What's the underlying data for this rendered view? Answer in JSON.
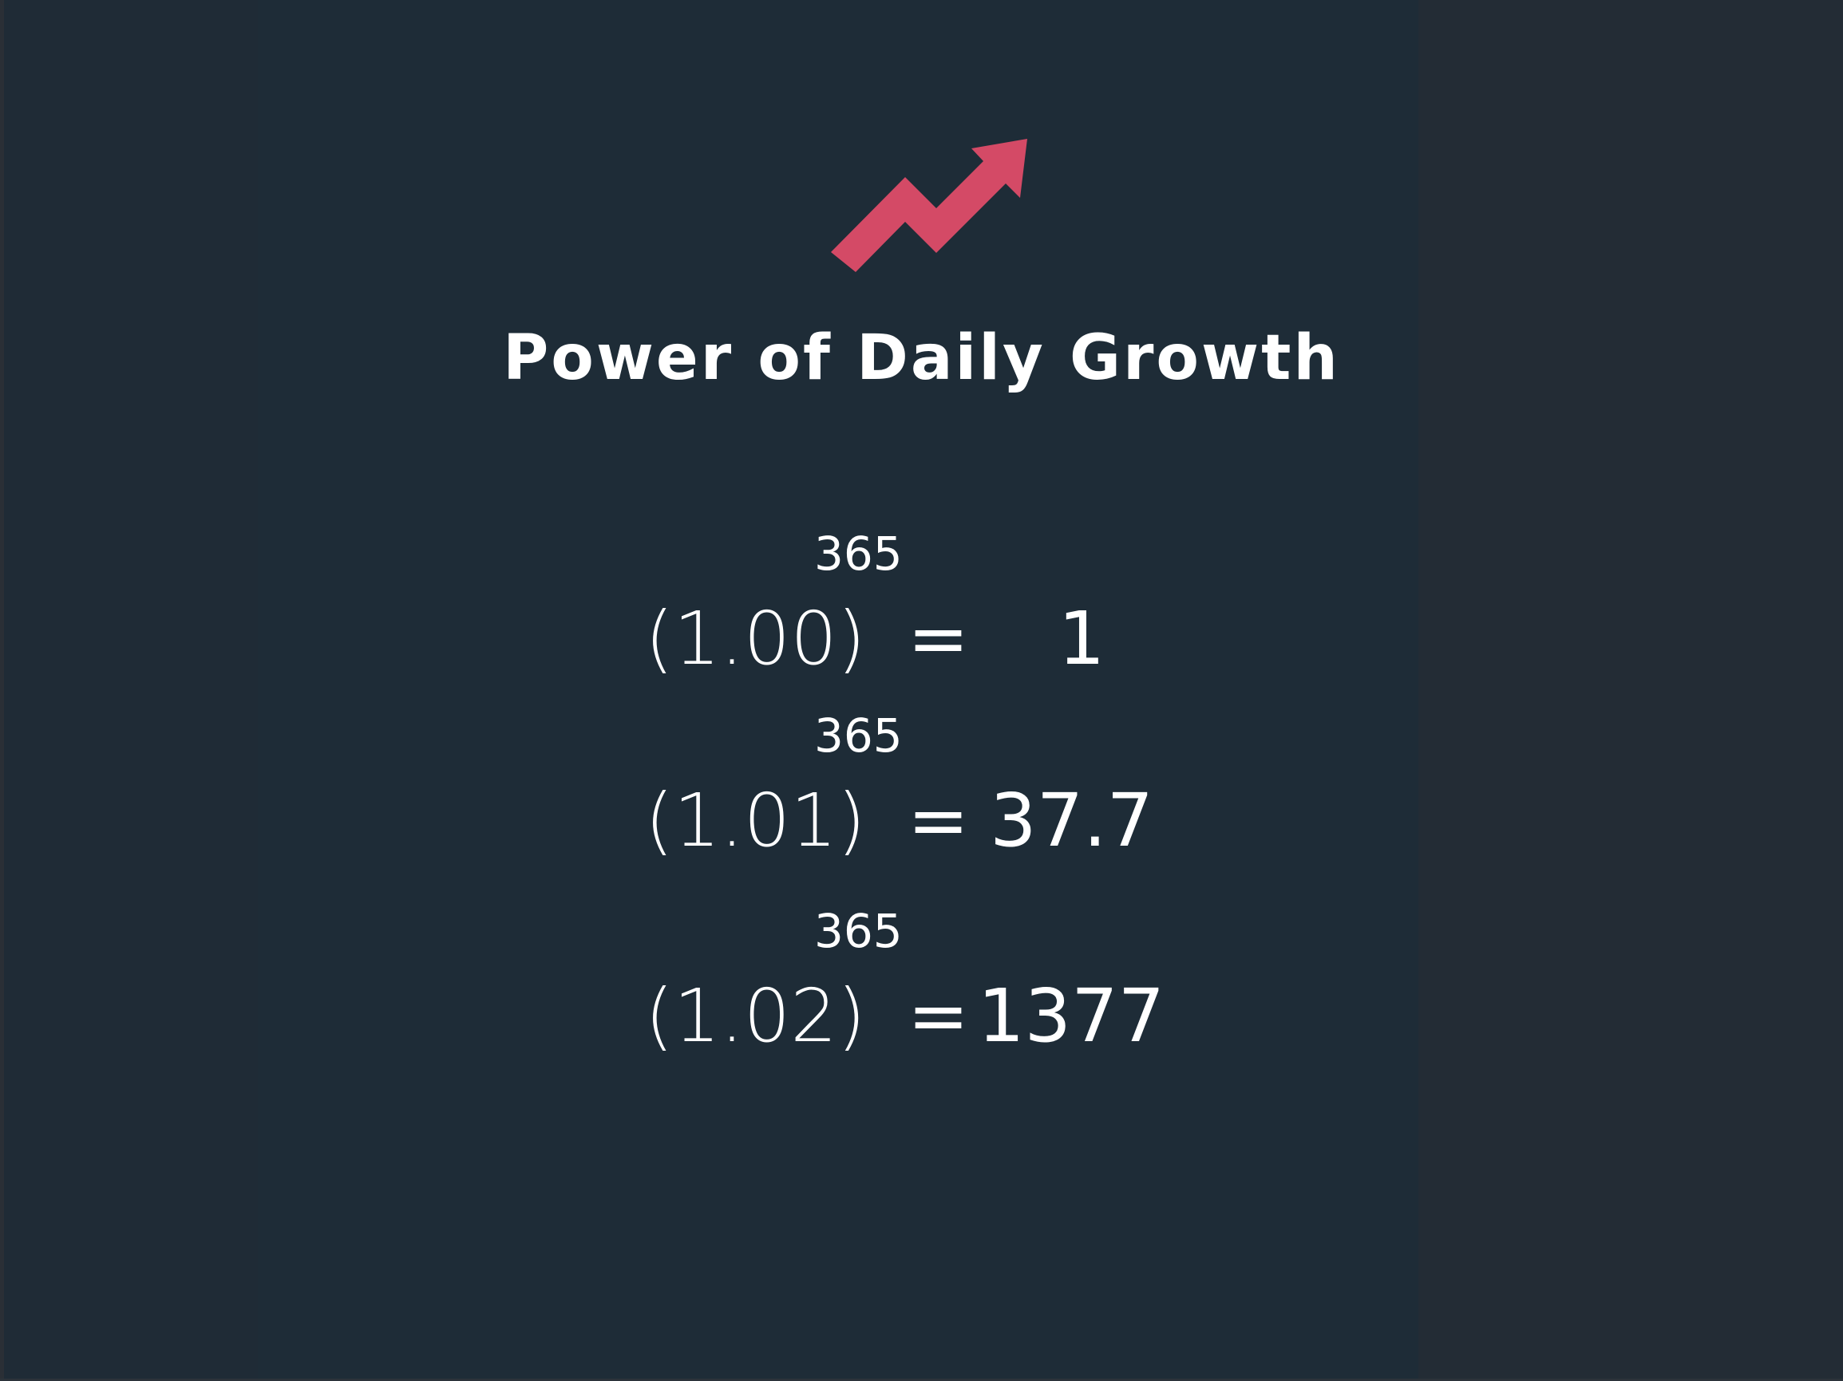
{
  "title": "Power of Daily Growth",
  "icon": {
    "name": "trending-up-arrow-icon",
    "color": "#d44a66"
  },
  "colors": {
    "background": "#1e2c37",
    "text": "#ffffff",
    "accent": "#d44a66"
  },
  "equations": [
    {
      "base": "(1.00)",
      "exponent": "365",
      "equals": "=",
      "result": "1"
    },
    {
      "base": "(1.01)",
      "exponent": "365",
      "equals": "=",
      "result": "37.7"
    },
    {
      "base": "(1.02)",
      "exponent": "365",
      "equals": "=",
      "result": "1377"
    }
  ]
}
